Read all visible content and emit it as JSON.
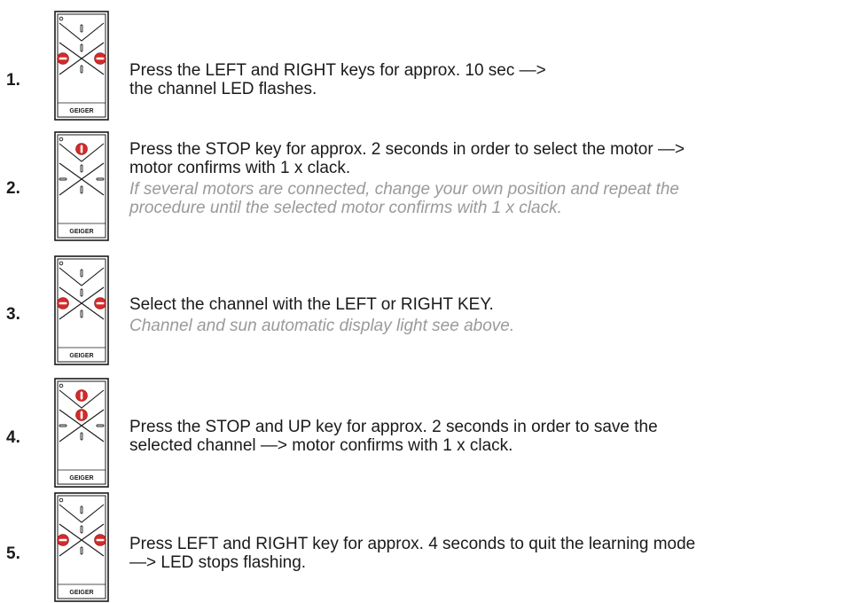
{
  "brand": "GEIGER",
  "steps": [
    {
      "number": "1.",
      "main_lines": [
        "Press the LEFT and RIGHT keys for approx. 10 sec —>",
        "the channel LED flashes."
      ],
      "note_lines": [],
      "pressed_keys": [
        "left",
        "right"
      ]
    },
    {
      "number": "2.",
      "main_lines": [
        "Press the STOP key for approx. 2 seconds in order to select the motor —>",
        "motor confirms with 1 x clack."
      ],
      "note_lines": [
        "If several motors are connected, change your own position and repeat the",
        "procedure until the selected motor confirms with 1 x clack."
      ],
      "pressed_keys": [
        "up"
      ]
    },
    {
      "number": "3.",
      "main_lines": [
        "Select the channel with the LEFT or RIGHT KEY."
      ],
      "note_lines": [
        "Channel and sun automatic display light see above."
      ],
      "pressed_keys": [
        "left",
        "right"
      ]
    },
    {
      "number": "4.",
      "main_lines": [
        "Press the STOP and UP key for approx. 2 seconds in order to save the",
        "selected channel —> motor confirms with 1 x clack."
      ],
      "note_lines": [],
      "pressed_keys": [
        "up",
        "center"
      ]
    },
    {
      "number": "5.",
      "main_lines": [
        "Press LEFT and RIGHT key for approx. 4 seconds to quit the learning mode",
        "—> LED stops flashing."
      ],
      "note_lines": [],
      "pressed_keys": [
        "left",
        "right"
      ]
    }
  ],
  "colors": {
    "pressed_key": "#d42a2a",
    "outline": "#1a1a1a",
    "note_text": "#9a9a9a"
  }
}
